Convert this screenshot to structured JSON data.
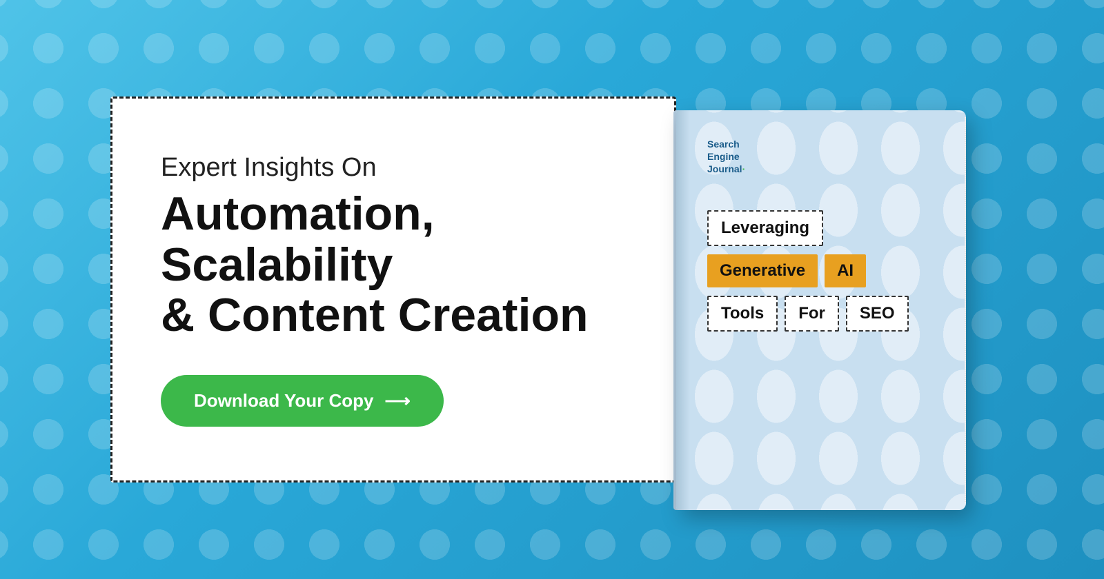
{
  "background": {
    "gradient_start": "#4fc3e8",
    "gradient_end": "#1e90c0"
  },
  "promo_box": {
    "subtitle": "Expert Insights On",
    "title_line1": "Automation, Scalability",
    "title_line2": "& Content Creation",
    "cta_button_label": "Download Your Copy",
    "cta_arrow": "⟶"
  },
  "book": {
    "publisher_line1": "Search",
    "publisher_line2": "Engine",
    "publisher_line3": "Journal",
    "publisher_dot": "·",
    "title_word1": "Leveraging",
    "title_word2": "Generative",
    "title_word3": "AI",
    "title_word4": "Tools",
    "title_word5": "For",
    "title_word6": "SEO"
  }
}
